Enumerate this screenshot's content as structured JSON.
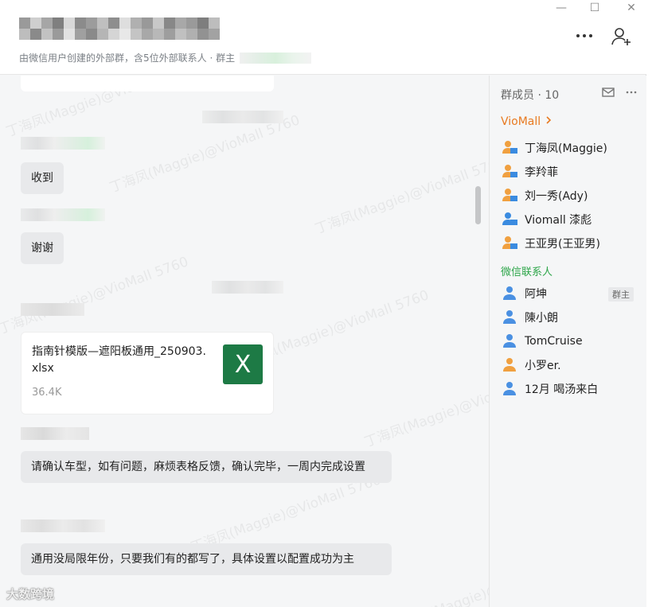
{
  "header": {
    "subtitle": "由微信用户创建的外部群，含5位外部联系人 · 群主",
    "more_icon": "more-horizontal-icon",
    "add_member_icon": "add-person-icon"
  },
  "window_controls": {
    "minimize": "—",
    "maximize": "☐",
    "close": "✕"
  },
  "watermark": "丁海凤(Maggie)@VioMall 5760",
  "messages": [
    {
      "text": "收到"
    },
    {
      "text": "谢谢"
    },
    {
      "text": "请确认车型，如有问题，麻烦表格反馈，确认完毕，一周内完成设置"
    },
    {
      "text": "通用没局限年份，只要我们有的都写了，具体设置以配置成功为主"
    }
  ],
  "file": {
    "name": "指南针模版—遮阳板通用_250903.xlsx",
    "size": "36.4K",
    "icon_label": "X"
  },
  "members_panel": {
    "title": "群成员 · 10",
    "group_viomall": "VioMall",
    "viomall_members": [
      "丁海凤(Maggie)",
      "李羚菲",
      "刘一秀(Ady)",
      "Viomall 漆彪",
      "王亚男(王亚男)"
    ],
    "group_wechat": "微信联系人",
    "wechat_members": [
      "阿坤",
      "陳小朗",
      "TomCruise",
      "小罗er.",
      "12月 喝汤来白"
    ],
    "owner_badge": "群主"
  },
  "logo_text": "大数跨境",
  "colors": {
    "viomall_accent": "#e87a21",
    "wechat_accent": "#2ea64a",
    "excel_green": "#1d7a45"
  }
}
